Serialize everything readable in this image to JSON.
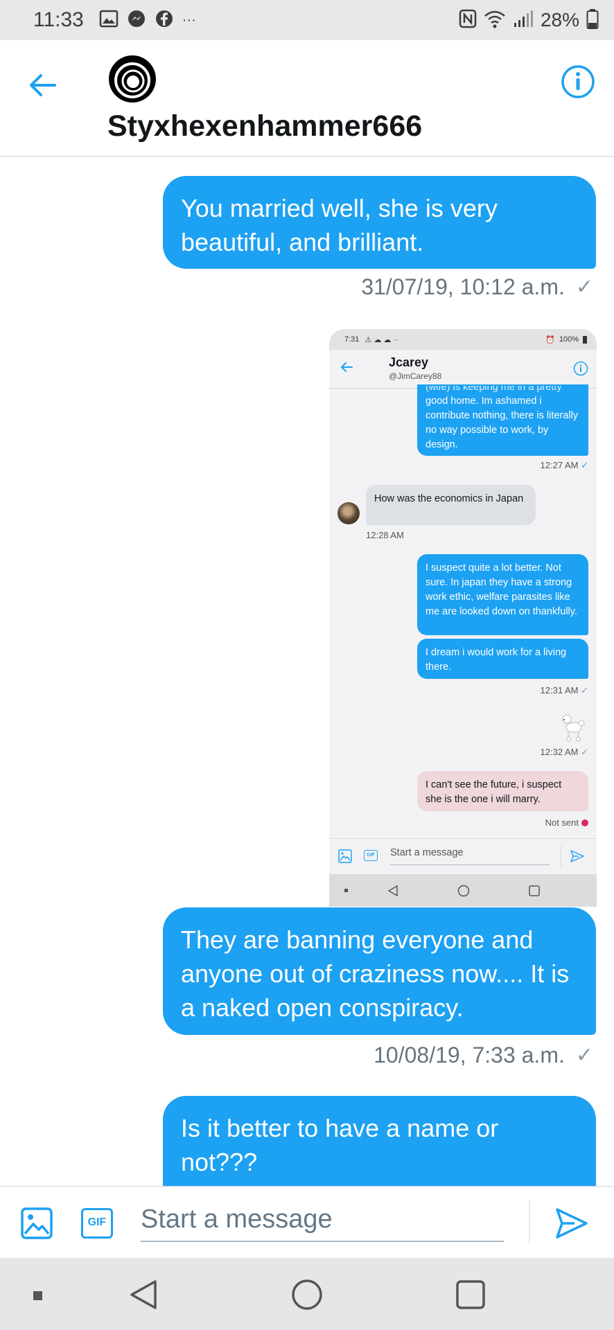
{
  "status_bar": {
    "time": "11:33",
    "ellipsis": "···",
    "battery": "28%"
  },
  "header": {
    "username": "Styxhexenhammer666"
  },
  "messages": [
    {
      "text": "You married well, she is very beautiful, and brilliant.",
      "timestamp": "31/07/19, 10:12 a.m."
    },
    {
      "text": "They are banning everyone and anyone out of craziness now.... It is a naked open conspiracy.",
      "timestamp": "10/08/19, 7:33 a.m."
    },
    {
      "text": "Is it better to have a name or not???"
    }
  ],
  "embedded_screenshot": {
    "status_time": "7:31",
    "status_battery": "100%",
    "name": "Jcarey",
    "handle": "@JimCarey88",
    "msg1_cut": "(wife) is keeping me in a pretty",
    "msg1": "good home. Im ashamed i contribute nothing, there is literally no way possible to work, by design.",
    "time1": "12:27 AM",
    "msg2": "How was the economics in Japan",
    "time2": "12:28 AM",
    "msg3": "I suspect quite a lot better. Not sure. In japan they have a strong work ethic, welfare parasites like me are looked down on thankfully.",
    "msg4": "I dream i would work for a living there.",
    "time3": "12:31 AM",
    "time4": "12:32 AM",
    "msg5": "I can't see the future, i suspect she is the one i will marry.",
    "not_sent": "Not sent",
    "placeholder": "Start a message",
    "gif_label": "GIF"
  },
  "composer": {
    "placeholder": "Start a message",
    "gif_label": "GIF"
  },
  "colors": {
    "accent": "#1da1f2",
    "text": "#14171a",
    "muted": "#66757f"
  }
}
